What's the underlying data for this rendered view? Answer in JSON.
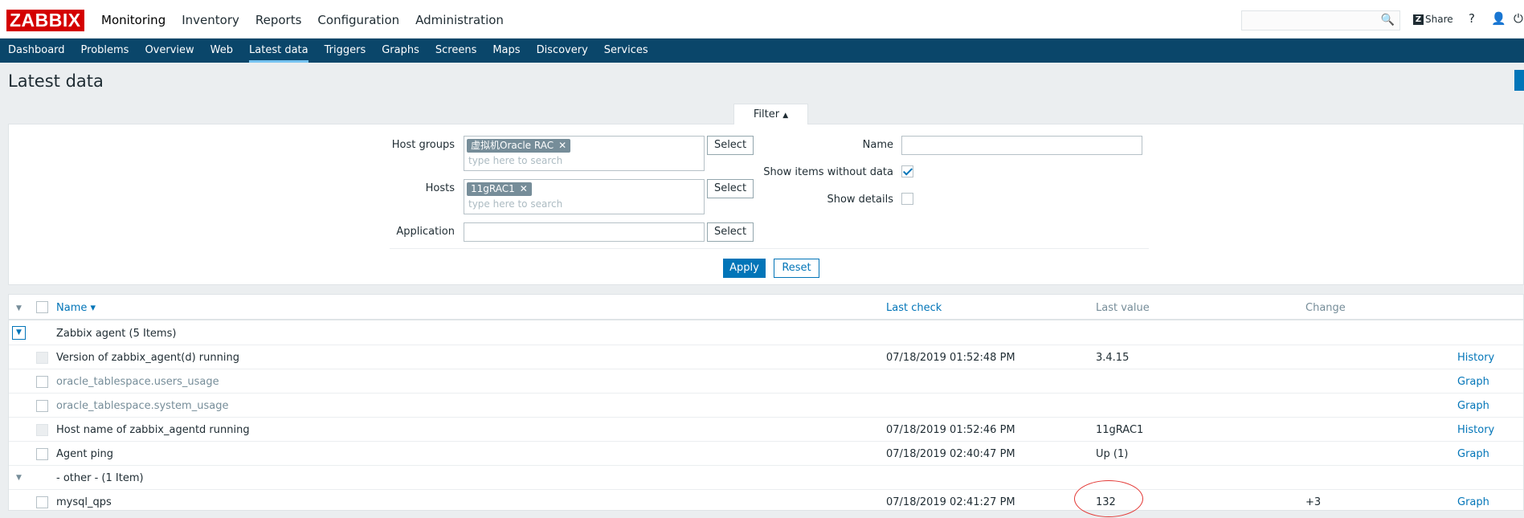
{
  "brand": {
    "logo": "ZABBIX",
    "logo_color": "#d40000",
    "accent": "#0275b8",
    "submenu_bg": "#0a466a"
  },
  "main_menu": [
    "Monitoring",
    "Inventory",
    "Reports",
    "Configuration",
    "Administration"
  ],
  "header": {
    "search_placeholder": "",
    "share_icon": "Z",
    "share_label": "Share",
    "help_icon": "?",
    "user_icon": "👤",
    "power_icon": "⏻"
  },
  "sub_menu": [
    "Dashboard",
    "Problems",
    "Overview",
    "Web",
    "Latest data",
    "Triggers",
    "Graphs",
    "Screens",
    "Maps",
    "Discovery",
    "Services"
  ],
  "page_title": "Latest data",
  "filter": {
    "tab_label": "Filter",
    "host_groups_label": "Host groups",
    "host_groups_tag": "虚拟机Oracle RAC",
    "hosts_label": "Hosts",
    "hosts_tag": "11gRAC1",
    "search_placeholder": "type here to search",
    "application_label": "Application",
    "select_label": "Select",
    "name_label": "Name",
    "show_without_data_label": "Show items without data",
    "show_without_data_checked": true,
    "show_details_label": "Show details",
    "show_details_checked": false,
    "apply_label": "Apply",
    "reset_label": "Reset"
  },
  "table": {
    "columns": {
      "name": "Name ▾",
      "last_check": "Last check",
      "last_value": "Last value",
      "change": "Change"
    },
    "group1": {
      "name": "Zabbix agent",
      "count": "(5 Items)"
    },
    "group2": {
      "name": "- other -",
      "count": "(1 Item)"
    },
    "rows": [
      {
        "name": "Version of zabbix_agent(d) running",
        "last_check": "07/18/2019 01:52:48 PM",
        "last_value": "3.4.15",
        "change": "",
        "action": "History",
        "muted": false,
        "disabled": true
      },
      {
        "name": "oracle_tablespace.users_usage",
        "last_check": "",
        "last_value": "",
        "change": "",
        "action": "Graph",
        "muted": true,
        "disabled": false
      },
      {
        "name": "oracle_tablespace.system_usage",
        "last_check": "",
        "last_value": "",
        "change": "",
        "action": "Graph",
        "muted": true,
        "disabled": false
      },
      {
        "name": "Host name of zabbix_agentd running",
        "last_check": "07/18/2019 01:52:46 PM",
        "last_value": "11gRAC1",
        "change": "",
        "action": "History",
        "muted": false,
        "disabled": true
      },
      {
        "name": "Agent ping",
        "last_check": "07/18/2019 02:40:47 PM",
        "last_value": "Up (1)",
        "change": "",
        "action": "Graph",
        "muted": false,
        "disabled": false
      },
      {
        "name": "mysql_qps",
        "last_check": "07/18/2019 02:41:27 PM",
        "last_value": "132",
        "change": "+3",
        "action": "Graph",
        "muted": false,
        "disabled": false
      }
    ]
  }
}
